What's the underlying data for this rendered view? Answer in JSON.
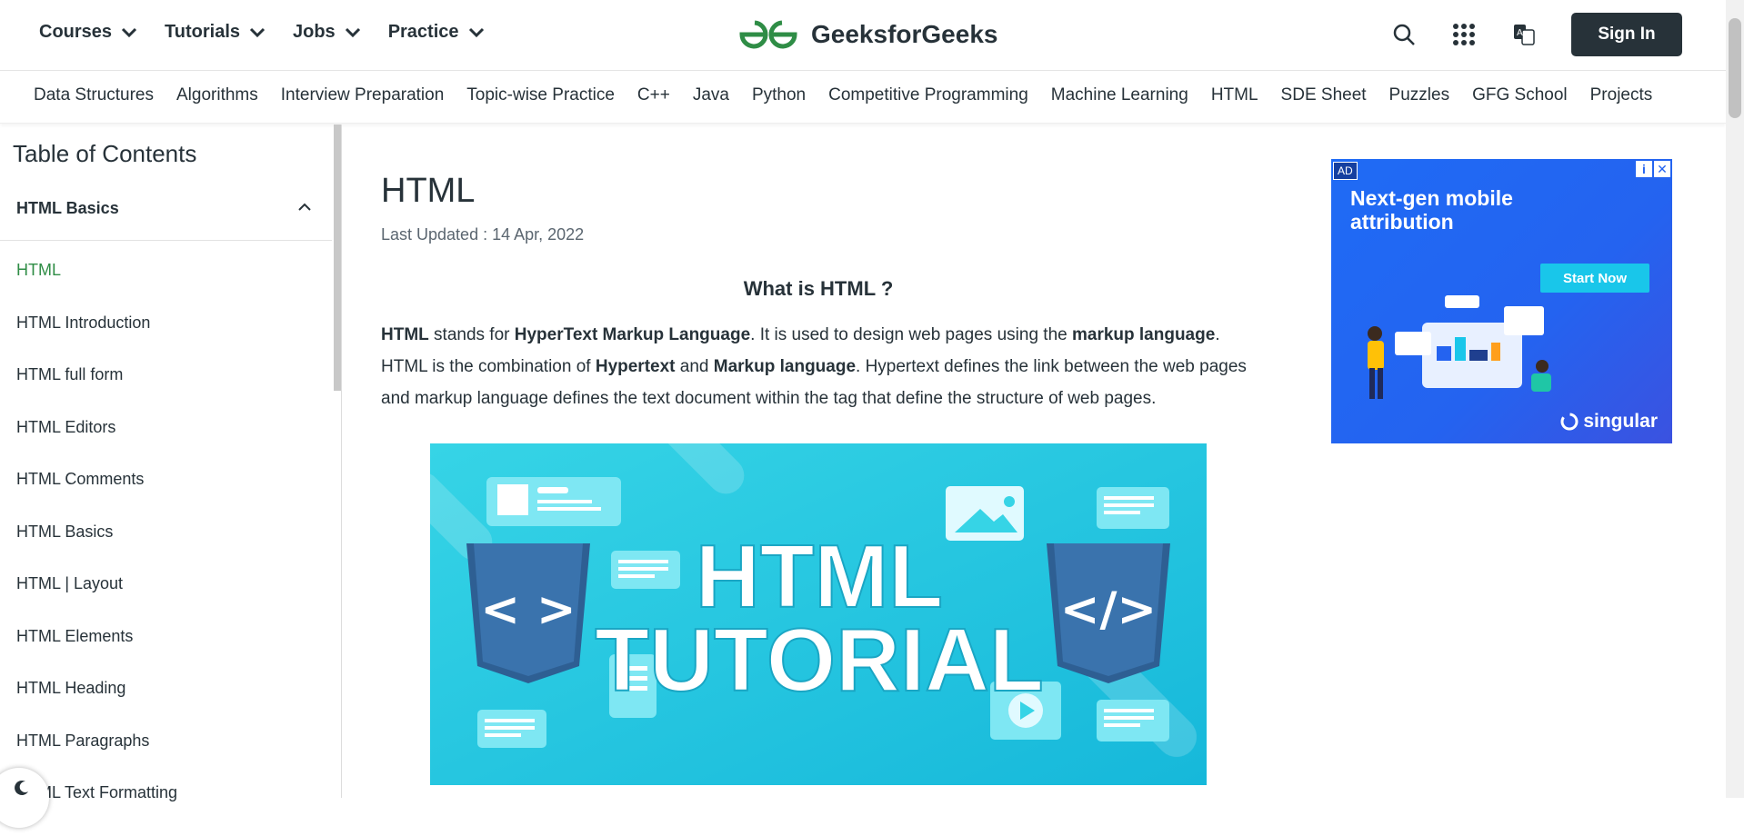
{
  "header": {
    "nav": [
      {
        "label": "Courses"
      },
      {
        "label": "Tutorials"
      },
      {
        "label": "Jobs"
      },
      {
        "label": "Practice"
      }
    ],
    "logo_text": "GeeksforGeeks",
    "signin_label": "Sign In",
    "icons": [
      "search-icon",
      "apps-grid-icon",
      "translate-icon"
    ]
  },
  "subnav": [
    "Data Structures",
    "Algorithms",
    "Interview Preparation",
    "Topic-wise Practice",
    "C++",
    "Java",
    "Python",
    "Competitive Programming",
    "Machine Learning",
    "HTML",
    "SDE Sheet",
    "Puzzles",
    "GFG School",
    "Projects"
  ],
  "sidebar": {
    "title": "Table of Contents",
    "section": "HTML Basics",
    "items": [
      "HTML",
      "HTML Introduction",
      "HTML full form",
      "HTML Editors",
      "HTML Comments",
      "HTML Basics",
      "HTML | Layout",
      "HTML Elements",
      "HTML Heading",
      "HTML Paragraphs",
      "HTML Text Formatting"
    ],
    "active_index": 0,
    "active_color": "#2f8d46"
  },
  "article": {
    "title": "HTML",
    "updated": "Last Updated : 14 Apr, 2022",
    "subheading": "What is HTML ?",
    "para": {
      "p1": "HTML",
      "p2": " stands for ",
      "p3": "HyperText Markup Language",
      "p4": ". It is used to design web pages using the ",
      "p5": "markup language",
      "p6": ". HTML is the combination of ",
      "p7": "Hypertext",
      "p8": " and ",
      "p9": "Markup language",
      "p10": ". Hypertext defines the link between the web pages and markup language defines the text document within the tag that define the structure of web pages."
    },
    "hero": {
      "line1": "HTML",
      "line2": "TUTORIAL",
      "left_tag": "< >",
      "right_tag": "</>"
    }
  },
  "ad": {
    "tag": "AD",
    "headline1": "Next-gen mobile",
    "headline2": "attribution",
    "cta": "Start Now",
    "brand": "singular"
  },
  "colors": {
    "brand_green": "#2f8d46",
    "dark": "#273239"
  }
}
